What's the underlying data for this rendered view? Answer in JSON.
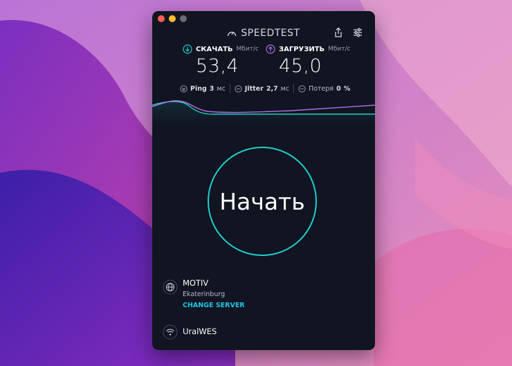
{
  "colors": {
    "accent_cyan": "#1fd1cc",
    "upload_violet": "#b26ee8",
    "link_blue": "#22c4e6",
    "window_bg": "#111421"
  },
  "app": {
    "title": "SPEEDTEST",
    "logo_icon": "speedometer-icon",
    "share_icon": "share-icon",
    "settings_icon": "sliders-icon"
  },
  "download": {
    "label": "СКАЧАТЬ",
    "unit": "Мбит/с",
    "value": "53,4",
    "icon": "arrow-down-circle-icon"
  },
  "upload": {
    "label": "ЗАГРУЗИТЬ",
    "unit": "Мбит/с",
    "value": "45,0",
    "icon": "arrow-up-circle-icon"
  },
  "stats": {
    "ping_label": "Ping",
    "ping_value": "3",
    "ping_unit": "мс",
    "jitter_label": "Jitter",
    "jitter_value": "2,7",
    "jitter_unit": "мс",
    "loss_label": "Потеря",
    "loss_value": "0",
    "loss_unit": "%"
  },
  "start": {
    "label": "Начать"
  },
  "server": {
    "name": "MOTIV",
    "city": "Ekaterinburg",
    "change_label": "CHANGE SERVER",
    "icon": "globe-icon"
  },
  "isp": {
    "name": "UralWES",
    "icon": "wifi-icon"
  }
}
